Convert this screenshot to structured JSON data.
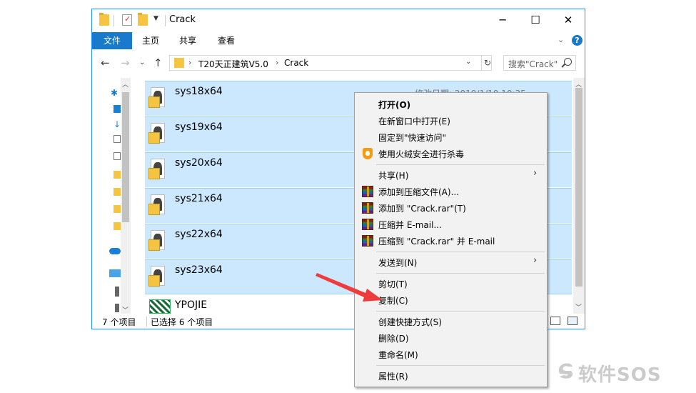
{
  "window": {
    "title": "Crack"
  },
  "ribbon": {
    "tabs": [
      {
        "label": "文件",
        "active": true
      },
      {
        "label": "主页"
      },
      {
        "label": "共享"
      },
      {
        "label": "查看"
      }
    ]
  },
  "address": {
    "crumbs": [
      "T20天正建筑V5.0",
      "Crack"
    ],
    "search_placeholder": "搜索\"Crack\""
  },
  "files": [
    {
      "name": "sys18x64",
      "date": "修改日期: 2019/1/10 10:35"
    },
    {
      "name": "sys19x64"
    },
    {
      "name": "sys20x64"
    },
    {
      "name": "sys21x64"
    },
    {
      "name": "sys22x64"
    },
    {
      "name": "sys23x64"
    },
    {
      "name": "YPOJIE"
    }
  ],
  "status": {
    "count": "7 个项目",
    "selected": "已选择 6 个项目"
  },
  "context_menu": {
    "open": "打开(O)",
    "open_new_window": "在新窗口中打开(E)",
    "pin_quick_access": "固定到\"快速访问\"",
    "virus_scan": "使用火绒安全进行杀毒",
    "share": "共享(H)",
    "add_archive": "添加到压缩文件(A)...",
    "add_crack_rar": "添加到 \"Crack.rar\"(T)",
    "compress_email": "压缩并 E-mail...",
    "compress_crack_email": "压缩到 \"Crack.rar\" 并 E-mail",
    "send_to": "发送到(N)",
    "cut": "剪切(T)",
    "copy": "复制(C)",
    "create_shortcut": "创建快捷方式(S)",
    "delete": "删除(D)",
    "rename": "重命名(M)",
    "properties": "属性(R)"
  },
  "watermark": "软件SOS",
  "colors": {
    "accent": "#1979ca",
    "selection": "#cce8ff",
    "arrow": "#ef3b3b"
  }
}
